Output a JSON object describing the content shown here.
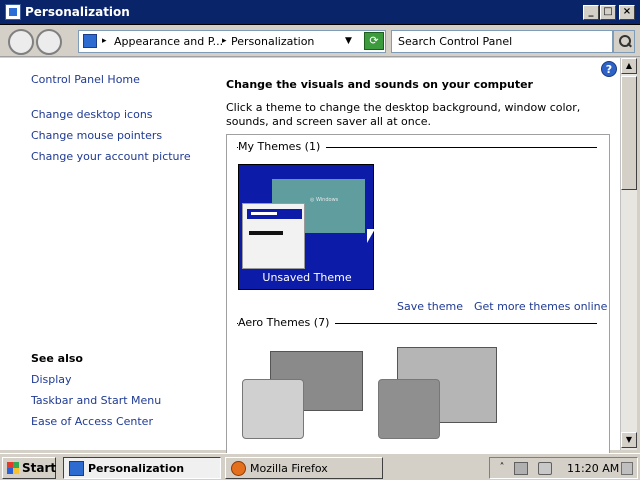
{
  "window": {
    "title": "Personalization"
  },
  "titlebar_buttons": {
    "minimize": "_",
    "maximize": "□",
    "close": "×"
  },
  "address": {
    "crumbs": [
      "Appearance and P...",
      "Personalization"
    ],
    "search_placeholder": "Search Control Panel"
  },
  "leftnav": {
    "home": "Control Panel Home",
    "links": [
      "Change desktop icons",
      "Change mouse pointers",
      "Change your account picture"
    ],
    "see_also_title": "See also",
    "see_also": [
      "Display",
      "Taskbar and Start Menu",
      "Ease of Access Center"
    ]
  },
  "main": {
    "heading": "Change the visuals and sounds on your computer",
    "description": "Click a theme to change the desktop background, window color, sounds, and screen saver all at once.",
    "my_themes_title": "My Themes (1)",
    "unsaved_theme": "Unsaved Theme",
    "save_theme": "Save theme",
    "get_more": "Get more themes online",
    "aero_title": "Aero Themes (7)"
  },
  "help": {
    "label": "?"
  },
  "taskbar": {
    "start": "Start",
    "tasks": [
      {
        "label": "Personalization",
        "active": true
      },
      {
        "label": "Mozilla Firefox",
        "active": false
      }
    ],
    "clock": "11:20 AM"
  },
  "colors": {
    "titlebar": "#0a246a",
    "link": "#1f3a93",
    "theme_bg": "#0d1ca8"
  }
}
